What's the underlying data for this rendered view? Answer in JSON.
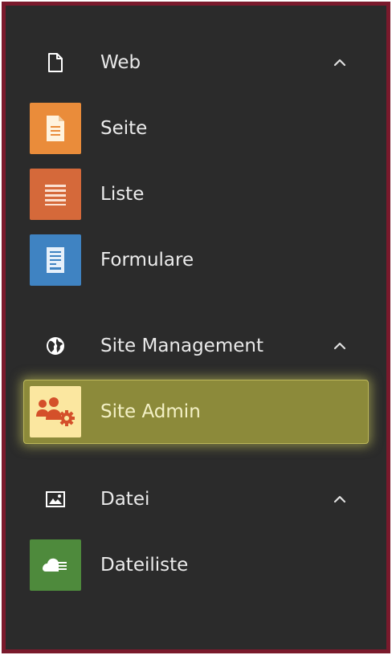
{
  "sections": [
    {
      "label": "Web",
      "icon": "document-icon",
      "expanded": true,
      "modules": [
        {
          "label": "Seite",
          "icon": "page-icon",
          "color": "#ea8c3a"
        },
        {
          "label": "Liste",
          "icon": "list-icon",
          "color": "#d5693a"
        },
        {
          "label": "Formulare",
          "icon": "form-icon",
          "color": "#3f83c2"
        }
      ]
    },
    {
      "label": "Site Management",
      "icon": "globe-icon",
      "expanded": true,
      "modules": [
        {
          "label": "Site Admin",
          "icon": "users-gear-icon",
          "color": "#fbe7a0",
          "active": true
        }
      ]
    },
    {
      "label": "Datei",
      "icon": "image-icon",
      "expanded": true,
      "modules": [
        {
          "label": "Dateiliste",
          "icon": "cloud-list-icon",
          "color": "#4e8a3c"
        }
      ]
    }
  ],
  "colors": {
    "background": "#2b2b2b",
    "frame": "#7a1a2c",
    "highlight": "#8c8a3a"
  }
}
